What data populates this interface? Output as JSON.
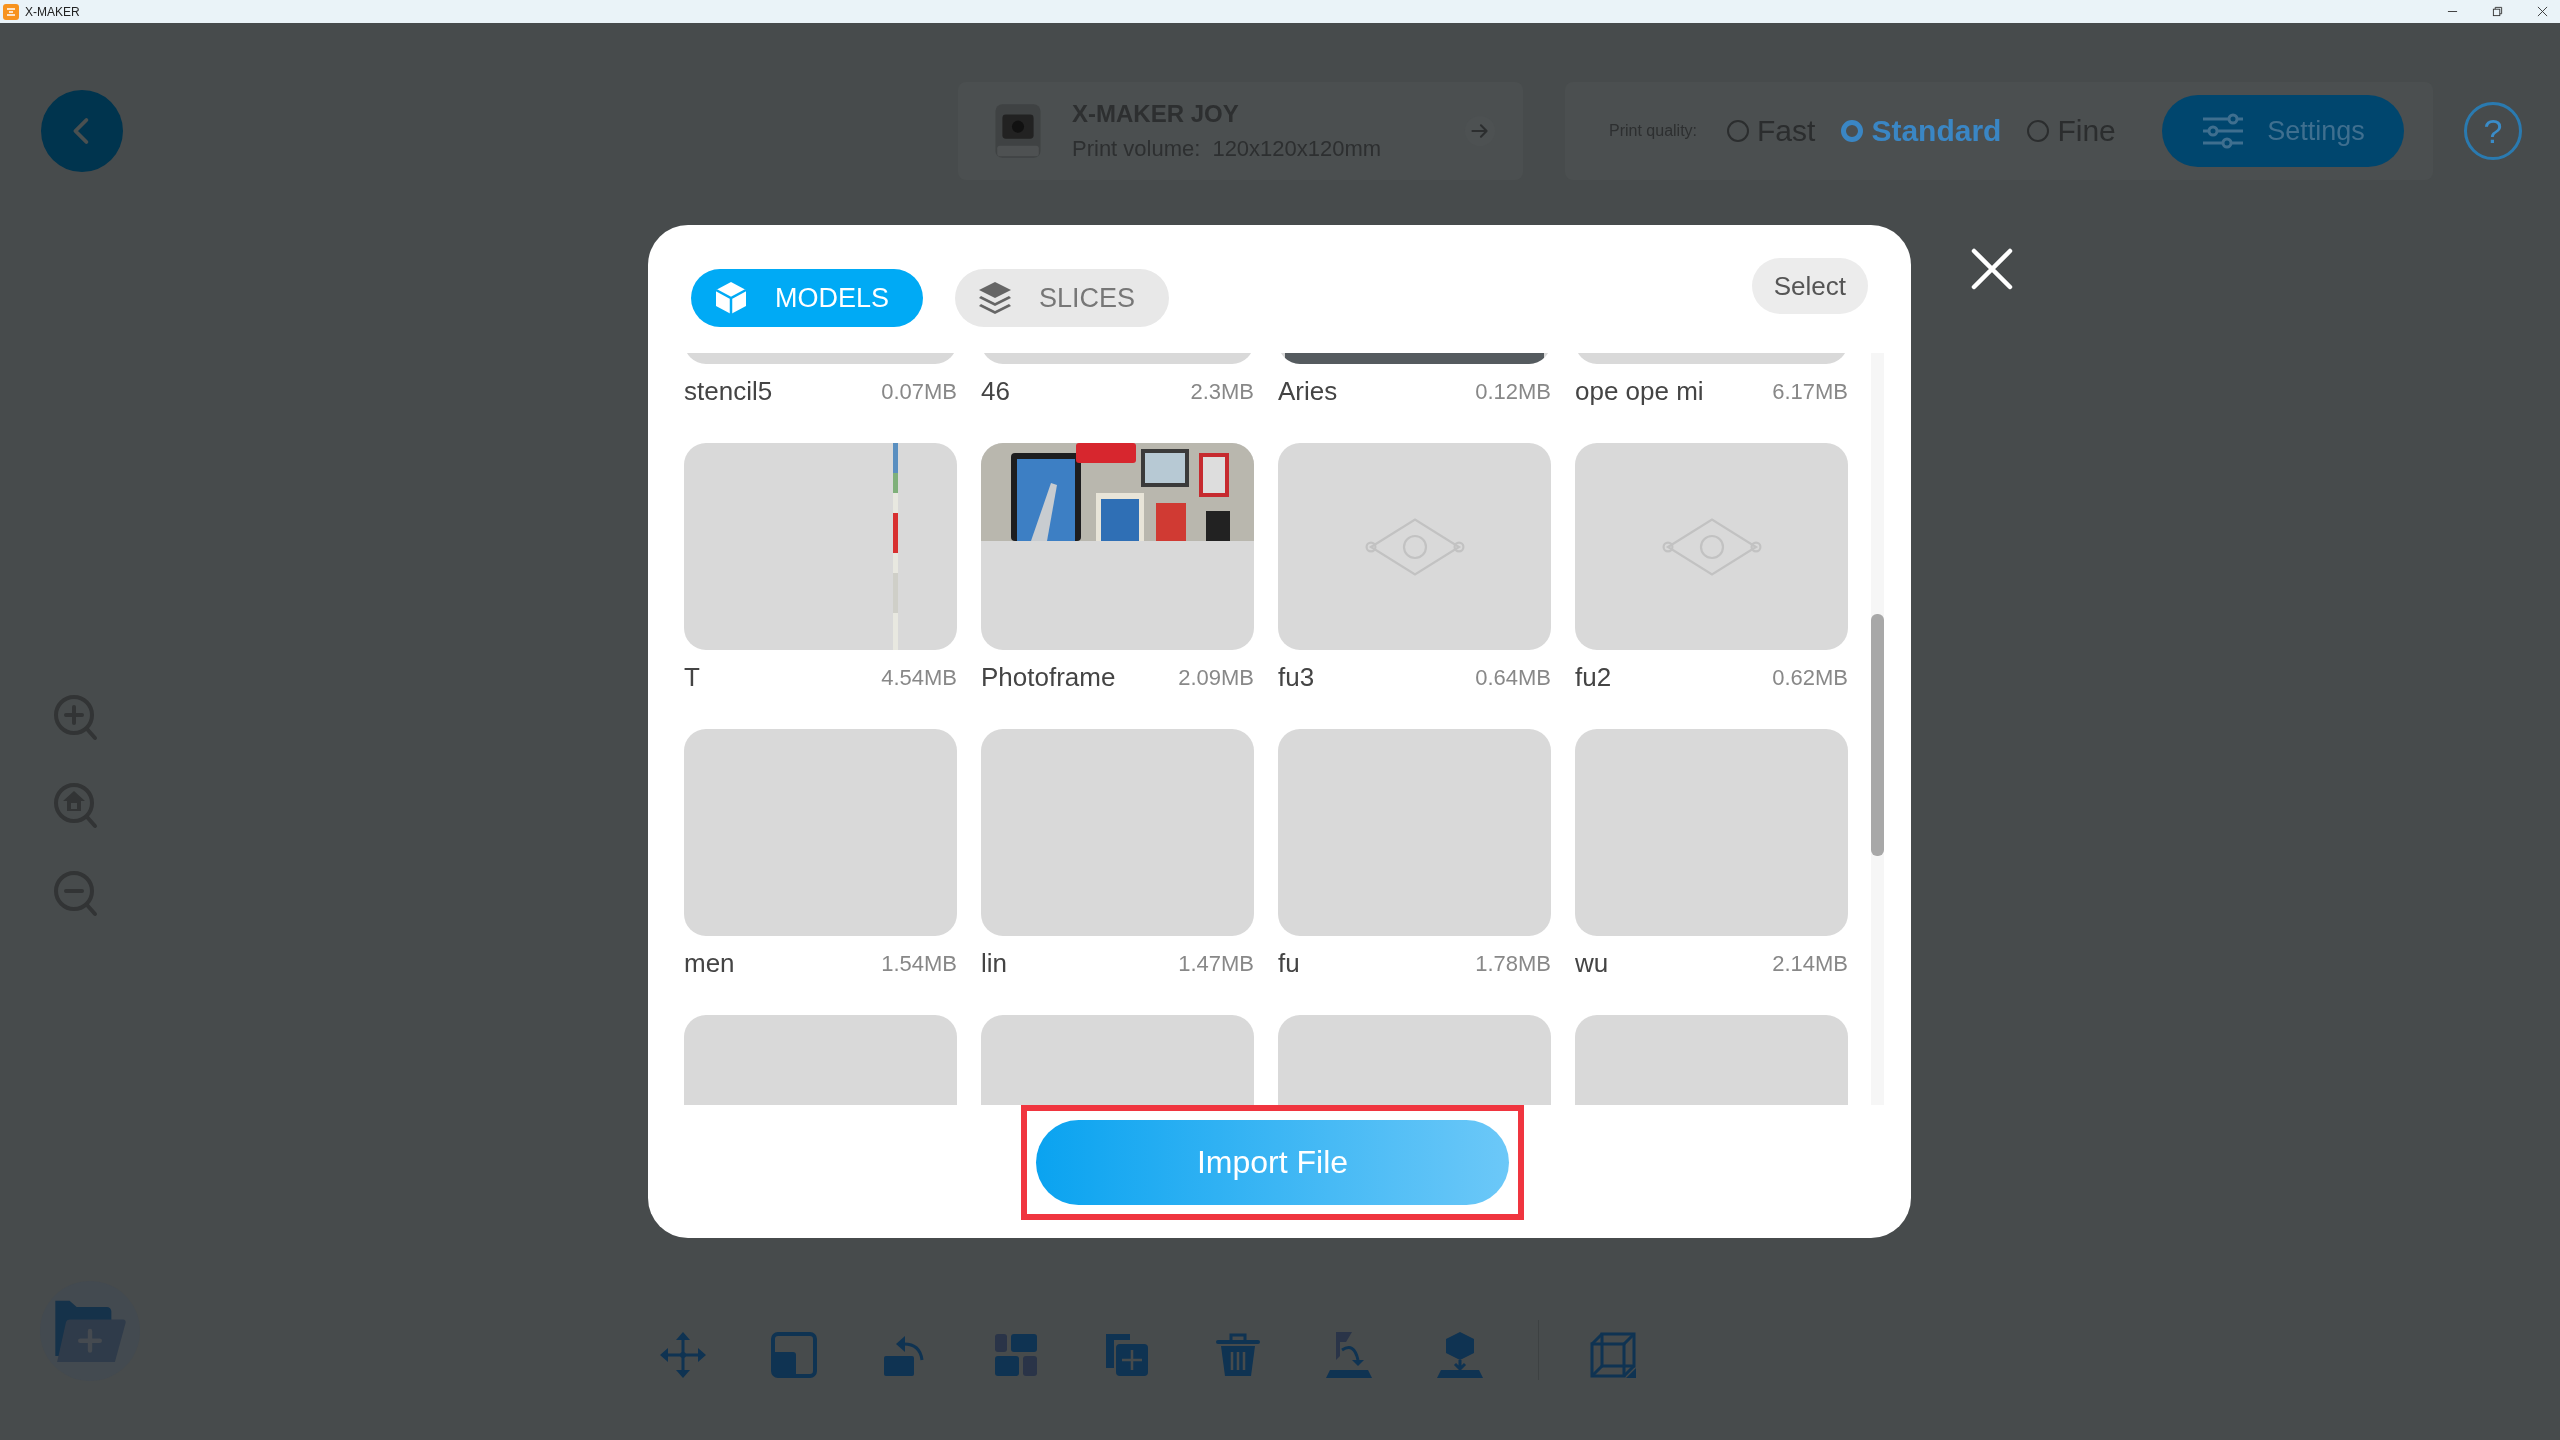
{
  "window": {
    "title": "X-MAKER"
  },
  "printer": {
    "name": "X-MAKER JOY",
    "volume_label": "Print volume:",
    "volume": "120x120x120mm"
  },
  "print_quality": {
    "label": "Print quality:",
    "options": [
      {
        "label": "Fast",
        "selected": false
      },
      {
        "label": "Standard",
        "selected": true
      },
      {
        "label": "Fine",
        "selected": false
      }
    ]
  },
  "settings_button": "Settings",
  "help_button": "?",
  "dialog": {
    "tabs": [
      {
        "label": "MODELS",
        "selected": true,
        "kind": "models"
      },
      {
        "label": "SLICES",
        "selected": false,
        "kind": "slices"
      }
    ],
    "select_button": "Select",
    "items": [
      {
        "name": "stencil5",
        "size": "0.07MB",
        "kind": "blank"
      },
      {
        "name": "46",
        "size": "2.3MB",
        "kind": "blank"
      },
      {
        "name": "Aries",
        "size": "0.12MB",
        "kind": "dark"
      },
      {
        "name": "ope ope mi",
        "size": "6.17MB",
        "kind": "blank"
      },
      {
        "name": "T",
        "size": "4.54MB",
        "kind": "strip"
      },
      {
        "name": "Photoframe",
        "size": "2.09MB"
      },
      {
        "name": "fu3",
        "size": "0.64MB",
        "kind": "relief"
      },
      {
        "name": "fu2",
        "size": "0.62MB",
        "kind": "relief"
      },
      {
        "name": "men",
        "size": "1.54MB",
        "kind": "blank"
      },
      {
        "name": "lin",
        "size": "1.47MB",
        "kind": "blank"
      },
      {
        "name": "fu",
        "size": "1.78MB",
        "kind": "blank"
      },
      {
        "name": "wu",
        "size": "2.14MB",
        "kind": "blank"
      },
      {
        "kind": "blank"
      },
      {
        "kind": "blank"
      },
      {
        "kind": "blank"
      },
      {
        "kind": "blank"
      }
    ],
    "import_button": "Import File"
  }
}
